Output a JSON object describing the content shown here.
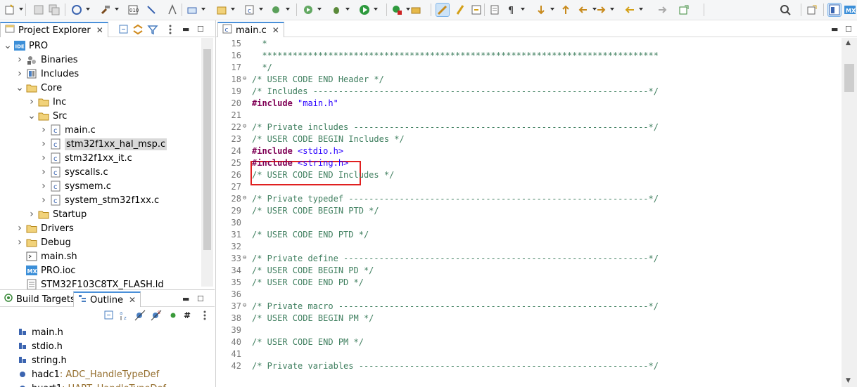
{
  "toolbar": {
    "icons": [
      "new-icon",
      "save-icon",
      "save-all-icon",
      "manage-config-icon",
      "build-icon",
      "build-all-icon",
      "debug-config-icon",
      "bug-target-icon",
      "connect-icon",
      "new-c-project-icon",
      "open-type-icon",
      "new-c-class-icon",
      "new-file-icon",
      "debug-icon",
      "run-icon",
      "external-tools-icon",
      "search-icon",
      "mark-occurrences-icon",
      "highlight-icon",
      "show-whitespace-icon",
      "next-annotation-icon",
      "prev-annotation-icon",
      "last-edit-icon",
      "back-icon",
      "forward-icon",
      "pin-editor-icon",
      "info-icon",
      "search-right-icon",
      "open-perspective-icon",
      "cpp-perspective-icon",
      "mx-perspective-icon"
    ]
  },
  "project_explorer": {
    "tab_label": "Project Explorer",
    "items": [
      {
        "label": "PRO",
        "icon": "ide-project-icon"
      },
      {
        "label": "Binaries",
        "icon": "binaries-icon"
      },
      {
        "label": "Includes",
        "icon": "includes-icon"
      },
      {
        "label": "Core",
        "icon": "folder-icon"
      },
      {
        "label": "Inc",
        "icon": "folder-icon"
      },
      {
        "label": "Src",
        "icon": "folder-icon"
      },
      {
        "label": "main.c",
        "icon": "c-file-icon"
      },
      {
        "label": "stm32f1xx_hal_msp.c",
        "icon": "c-file-icon"
      },
      {
        "label": "stm32f1xx_it.c",
        "icon": "c-file-icon"
      },
      {
        "label": "syscalls.c",
        "icon": "c-file-icon"
      },
      {
        "label": "sysmem.c",
        "icon": "c-file-icon"
      },
      {
        "label": "system_stm32f1xx.c",
        "icon": "c-file-icon"
      },
      {
        "label": "Startup",
        "icon": "folder-icon"
      },
      {
        "label": "Drivers",
        "icon": "folder-icon"
      },
      {
        "label": "Debug",
        "icon": "folder-icon"
      },
      {
        "label": "main.sh",
        "icon": "script-file-icon"
      },
      {
        "label": "PRO.ioc",
        "icon": "mx-file-icon"
      },
      {
        "label": "STM32F103C8TX_FLASH.ld",
        "icon": "ld-file-icon"
      }
    ]
  },
  "outline": {
    "tab_build": "Build Targets",
    "tab_outline": "Outline",
    "items": [
      {
        "label": "main.h",
        "type": ""
      },
      {
        "label": "stdio.h",
        "type": ""
      },
      {
        "label": "string.h",
        "type": ""
      },
      {
        "label": "hadc1",
        "type": " : ADC_HandleTypeDef"
      },
      {
        "label": "huart1",
        "type": " : UART_HandleTypeDef"
      }
    ]
  },
  "editor": {
    "tab_label": "main.c",
    "lines": [
      {
        "n": "15",
        "text": "  *",
        "style": "cmt",
        "fold": ""
      },
      {
        "n": "16",
        "text": "  ******************************************************************************",
        "style": "cmt",
        "fold": ""
      },
      {
        "n": "17",
        "text": "  */",
        "style": "cmt",
        "fold": ""
      },
      {
        "n": "18",
        "text": "/* USER CODE END Header */",
        "style": "cmt",
        "fold": "⊖"
      },
      {
        "n": "19",
        "text": "/* Includes ------------------------------------------------------------------*/",
        "style": "cmt",
        "fold": ""
      },
      {
        "n": "20",
        "kw": "#include",
        "rest": " \"main.h\"",
        "style": "inc",
        "fold": ""
      },
      {
        "n": "21",
        "text": "",
        "style": "cmt",
        "fold": ""
      },
      {
        "n": "22",
        "text": "/* Private includes ----------------------------------------------------------*/",
        "style": "cmt",
        "fold": "⊖"
      },
      {
        "n": "23",
        "text": "/* USER CODE BEGIN Includes */",
        "style": "cmt",
        "fold": ""
      },
      {
        "n": "24",
        "kw": "#include",
        "rest": " <stdio.h>",
        "style": "inc",
        "fold": ""
      },
      {
        "n": "25",
        "kw": "#include",
        "rest": " <string.h>",
        "style": "inc",
        "fold": ""
      },
      {
        "n": "26",
        "text": "/* USER CODE END Includes */",
        "style": "cmt",
        "fold": ""
      },
      {
        "n": "27",
        "text": "",
        "style": "cmt",
        "fold": ""
      },
      {
        "n": "28",
        "text": "/* Private typedef -----------------------------------------------------------*/",
        "style": "cmt",
        "fold": "⊖"
      },
      {
        "n": "29",
        "text": "/* USER CODE BEGIN PTD */",
        "style": "cmt",
        "fold": ""
      },
      {
        "n": "30",
        "text": "",
        "style": "cmt",
        "fold": ""
      },
      {
        "n": "31",
        "text": "/* USER CODE END PTD */",
        "style": "cmt",
        "fold": ""
      },
      {
        "n": "32",
        "text": "",
        "style": "cmt",
        "fold": ""
      },
      {
        "n": "33",
        "text": "/* Private define ------------------------------------------------------------*/",
        "style": "cmt",
        "fold": "⊖"
      },
      {
        "n": "34",
        "text": "/* USER CODE BEGIN PD */",
        "style": "cmt",
        "fold": ""
      },
      {
        "n": "35",
        "text": "/* USER CODE END PD */",
        "style": "cmt",
        "fold": ""
      },
      {
        "n": "36",
        "text": "",
        "style": "cmt",
        "fold": ""
      },
      {
        "n": "37",
        "text": "/* Private macro -------------------------------------------------------------*/",
        "style": "cmt",
        "fold": "⊖"
      },
      {
        "n": "38",
        "text": "/* USER CODE BEGIN PM */",
        "style": "cmt",
        "fold": ""
      },
      {
        "n": "39",
        "text": "",
        "style": "cmt",
        "fold": ""
      },
      {
        "n": "40",
        "text": "/* USER CODE END PM */",
        "style": "cmt",
        "fold": ""
      },
      {
        "n": "41",
        "text": "",
        "style": "cmt",
        "fold": ""
      },
      {
        "n": "42",
        "text": "/* Private variables ---------------------------------------------------------*/",
        "style": "cmt",
        "fold": ""
      }
    ]
  },
  "colors": {
    "accent": "#4a90d9",
    "highlight_box": "#e02020",
    "comment": "#3f7f5f",
    "keyword": "#7f0055",
    "string": "#2a00ff"
  }
}
